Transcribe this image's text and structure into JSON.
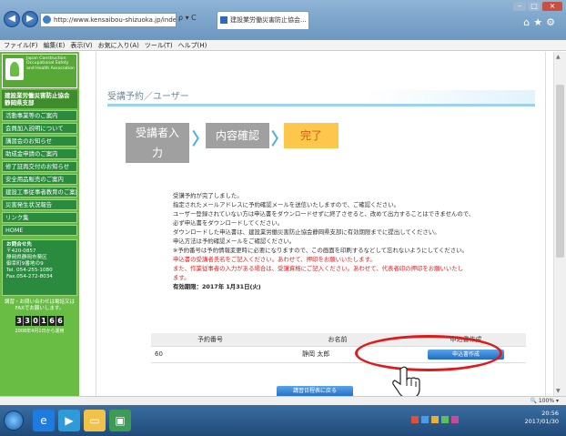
{
  "browser": {
    "address": "http://www.kensaibou-shizuoka.jp/index-2017.h",
    "address_controls": "ρ ▾ C",
    "tab_title": "建設業労働災害防止協会...",
    "tab_close": "×",
    "icons": [
      "home-icon",
      "star-icon",
      "gear-icon"
    ]
  },
  "menu": [
    "ファイル(F)",
    "編集(E)",
    "表示(V)",
    "お気に入り(A)",
    "ツール(T)",
    "ヘルプ(H)"
  ],
  "sidebar": {
    "logo_text": "Japan Construction Occupational Safety and Health Association",
    "association": "建設業労働災害防止協会 静岡県支部",
    "items": [
      "活動事業等のご案内",
      "会員加入説明について",
      "講習会のお知らせ",
      "助成金申請のご案内",
      "修了証再交付のお知らせ",
      "安全用品販売のご案内",
      "建設工事従事者教育のご案内",
      "災害発生状況報告",
      "リンク集",
      "HOME"
    ],
    "contact": {
      "title": "お問合せ先",
      "zip": "〒420-0857",
      "address1": "静岡県静岡市葵区",
      "address2": "御幸町9番地の9",
      "tel": "Tel. 054-255-1080",
      "fax": "Fax.054-272-8034"
    },
    "note": "講習・お問い合わせは電話又はFAXでお願いします。",
    "counter_digits": [
      "3",
      "3",
      "0",
      "1",
      "6",
      "6"
    ],
    "counter_note": "2008年4月1日から運用"
  },
  "main": {
    "section_title": "受講予約／ユーザー",
    "steps": {
      "step1_line1": "受講者入",
      "step1_line2": "力",
      "step2": "内容確認",
      "step3": "完了"
    },
    "messages": {
      "line1": "受講予約が完了しました。",
      "line2": "指定されたメールアドレスに予約確認メールを送信いたしますので、ご確認ください。",
      "line3": "ユーザー登録されていない方は申込書をダウンロードせずに終了させると、改めて出力することはできませんので、",
      "line4": "必ず申込書をダウンロードしてください。",
      "line5": "ダウンロードした申込書は、建設業労働災害防止協会静岡県支部に有効期限までに提出してください。",
      "line6": "申込方法は予約確認メールをご確認ください。",
      "line7": "※予約番号は予約情報変更時に必要になりますので、この画面を印刷するなどして忘れないようにしてください。",
      "red1": "申込書の受講者氏名をご記入ください。あわせて、押印をお願いいたします。",
      "red2": "また、作業従事者の入力がある場合は、受講資格にご記入ください。あわせて、代表者印の押印をお願いいたし",
      "red3": "ます。",
      "expiry": "有効期限：2017年 1月31日(火)"
    },
    "table": {
      "headers": [
        "予約番号",
        "お名前",
        "申込書作成"
      ],
      "row": {
        "number": "60",
        "name": "静岡 太郎",
        "button": "申込書作成"
      }
    },
    "back_button": "講習日程表に戻る"
  },
  "status": {
    "zoom": "100%"
  },
  "taskbar": {
    "time": "20:56",
    "date": "2017/01/30"
  }
}
